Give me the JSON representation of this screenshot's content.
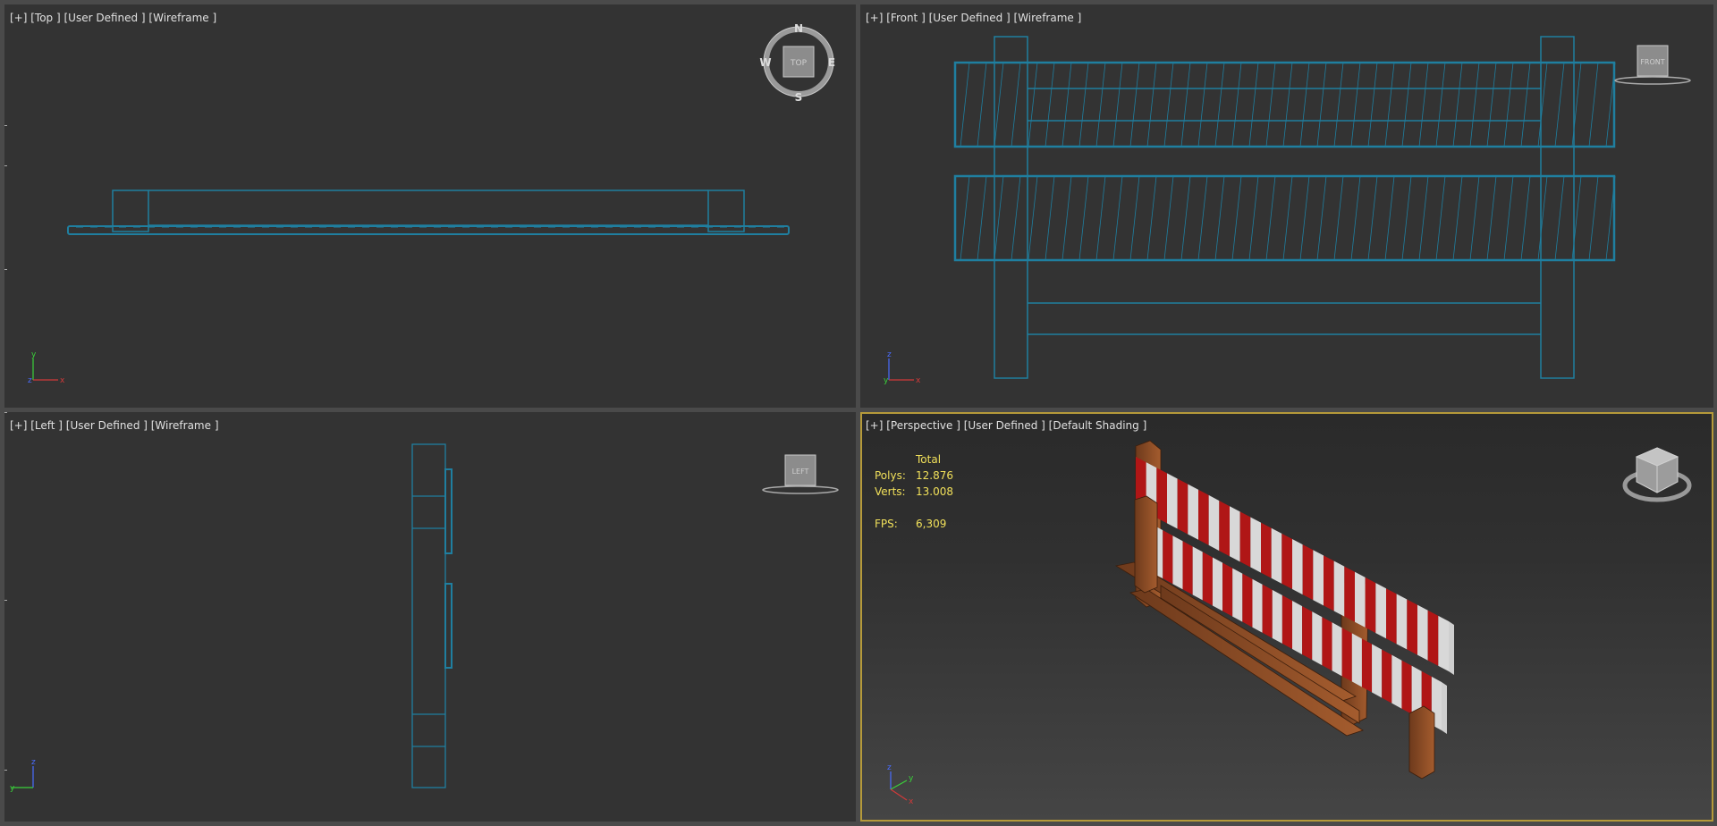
{
  "viewports": {
    "top": {
      "label": "[+] [Top ] [User Defined ] [Wireframe ]"
    },
    "front": {
      "label": "[+] [Front ] [User Defined ] [Wireframe ]"
    },
    "left": {
      "label": "[+] [Left ] [User Defined ] [Wireframe ]"
    },
    "perspective": {
      "label": "[+] [Perspective ] [User Defined ] [Default Shading ]"
    }
  },
  "compass": {
    "n": "N",
    "s": "S",
    "e": "E",
    "w": "W"
  },
  "viewcube": {
    "top": "TOP",
    "front": "FRONT",
    "left": "LEFT"
  },
  "axes": {
    "x": "x",
    "y": "y",
    "z": "z"
  },
  "stats": {
    "header": "Total",
    "polys_label": "Polys:",
    "polys_value": "12.876",
    "verts_label": "Verts:",
    "verts_value": "13.008",
    "fps_label": "FPS:",
    "fps_value": "6,309"
  },
  "colors": {
    "wire": "#1f7fa0",
    "active_border": "#b59a3a",
    "stats_text": "#f1e05a",
    "stripe_red": "#b01616",
    "stripe_white": "#d8d8d8",
    "wood": "#8a4a24"
  }
}
